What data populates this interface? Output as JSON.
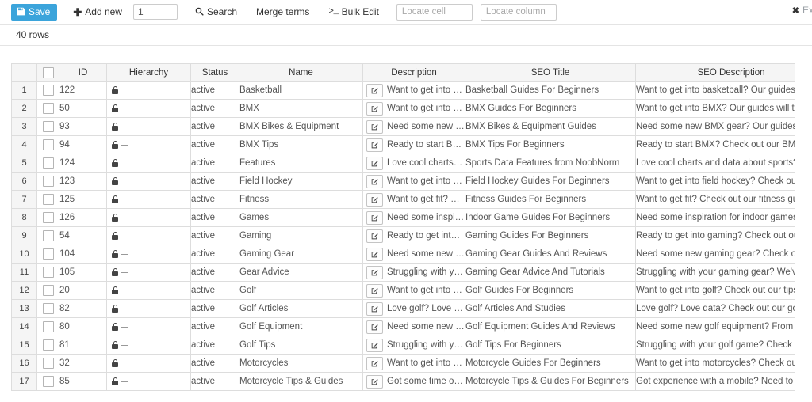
{
  "toolbar": {
    "save_label": "Save",
    "save_icon": "floppy-disk-icon",
    "add_new_label": "Add new",
    "add_new_count": "1",
    "search_label": "Search",
    "search_icon": "search-icon",
    "merge_terms_label": "Merge terms",
    "bulk_edit_label": "Bulk Edit",
    "bulk_edit_icon": ">_",
    "locate_cell_placeholder": "Locate cell",
    "locate_column_placeholder": "Locate column",
    "exit_label": "Exit",
    "exit_icon": "close-icon",
    "accent_color": "#3ba4db"
  },
  "status_bar": {
    "row_count_label": "40 rows"
  },
  "table": {
    "columns": [
      "",
      "",
      "ID",
      "Hierarchy",
      "Status",
      "Name",
      "Description",
      "SEO Title",
      "SEO Description"
    ],
    "rows": [
      {
        "num": "1",
        "id": "122",
        "child": false,
        "status": "active",
        "name": "Basketball",
        "description": "Want to get into b...",
        "seo_title": "Basketball Guides For Beginners",
        "seo_description": "Want to get into basketball? Our guides will t..."
      },
      {
        "num": "2",
        "id": "50",
        "child": false,
        "status": "active",
        "name": "BMX",
        "description": "Want to get into B...",
        "seo_title": "BMX Guides For Beginners",
        "seo_description": "Want to get into BMX? Our guides will teach ..."
      },
      {
        "num": "3",
        "id": "93",
        "child": true,
        "status": "active",
        "name": "BMX Bikes & Equipment",
        "description": "Need some new B...",
        "seo_title": "BMX Bikes & Equipment Guides",
        "seo_description": "Need some new BMX gear? Our guides will ..."
      },
      {
        "num": "4",
        "id": "94",
        "child": true,
        "status": "active",
        "name": "BMX Tips",
        "description": "Ready to start BM...",
        "seo_title": "BMX Tips For Beginners",
        "seo_description": "Ready to start BMX? Check out our BMX tips ..."
      },
      {
        "num": "5",
        "id": "124",
        "child": false,
        "status": "active",
        "name": "Features",
        "description": "Love cool charts a...",
        "seo_title": "Sports Data Features from NoobNorm",
        "seo_description": "Love cool charts and data about sports? The..."
      },
      {
        "num": "6",
        "id": "123",
        "child": false,
        "status": "active",
        "name": "Field Hockey",
        "description": "Want to get into fi...",
        "seo_title": "Field Hockey Guides For Beginners",
        "seo_description": "Want to get into field hockey? Check out our..."
      },
      {
        "num": "7",
        "id": "125",
        "child": false,
        "status": "active",
        "name": "Fitness",
        "description": "Want to get fit? Ch...",
        "seo_title": "Fitness Guides For Beginners",
        "seo_description": "Want to get fit? Check out our fitness guides..."
      },
      {
        "num": "8",
        "id": "126",
        "child": false,
        "status": "active",
        "name": "Games",
        "description": "Need some inspira...",
        "seo_title": "Indoor Game Guides For Beginners",
        "seo_description": "Need some inspiration for indoor games? Ch..."
      },
      {
        "num": "9",
        "id": "54",
        "child": false,
        "status": "active",
        "name": "Gaming",
        "description": "Ready to get into ...",
        "seo_title": "Gaming Guides For Beginners",
        "seo_description": "Ready to get into gaming? Check out our ga..."
      },
      {
        "num": "10",
        "id": "104",
        "child": true,
        "status": "active",
        "name": "Gaming Gear",
        "description": "Need some new g...",
        "seo_title": "Gaming Gear Guides And Reviews",
        "seo_description": "Need some new gaming gear? Check out ou..."
      },
      {
        "num": "11",
        "id": "105",
        "child": true,
        "status": "active",
        "name": "Gear Advice",
        "description": "Struggling with yo...",
        "seo_title": "Gaming Gear Advice And Tutorials",
        "seo_description": "Struggling with your gaming gear? We've go..."
      },
      {
        "num": "12",
        "id": "20",
        "child": false,
        "status": "active",
        "name": "Golf",
        "description": "Want to get into g...",
        "seo_title": "Golf Guides For Beginners",
        "seo_description": "Want to get into golf? Check out our tips, tut..."
      },
      {
        "num": "13",
        "id": "82",
        "child": true,
        "status": "active",
        "name": "Golf Articles",
        "description": "Love golf? Love da...",
        "seo_title": "Golf Articles And Studies",
        "seo_description": "Love golf? Love data? Check out our golf dat..."
      },
      {
        "num": "14",
        "id": "80",
        "child": true,
        "status": "active",
        "name": "Golf Equipment",
        "description": "Need some new g...",
        "seo_title": "Golf Equipment Guides And Reviews",
        "seo_description": "Need some new golf equipment? From clubs..."
      },
      {
        "num": "15",
        "id": "81",
        "child": true,
        "status": "active",
        "name": "Golf Tips",
        "description": "Struggling with yo...",
        "seo_title": "Golf Tips For Beginners",
        "seo_description": "Struggling with your golf game? Check out o..."
      },
      {
        "num": "16",
        "id": "32",
        "child": false,
        "status": "active",
        "name": "Motorcycles",
        "description": "Want to get into m...",
        "seo_title": "Motorcycle Guides For Beginners",
        "seo_description": "Want to get into motorcycles? Check out our..."
      },
      {
        "num": "17",
        "id": "85",
        "child": true,
        "status": "active",
        "name": "Motorcycle Tips & Guides",
        "description": "Got some time on ...",
        "seo_title": "Motorcycle Tips & Guides For Beginners",
        "seo_description": "Got experience with a mobile? Need to lear..."
      }
    ]
  }
}
